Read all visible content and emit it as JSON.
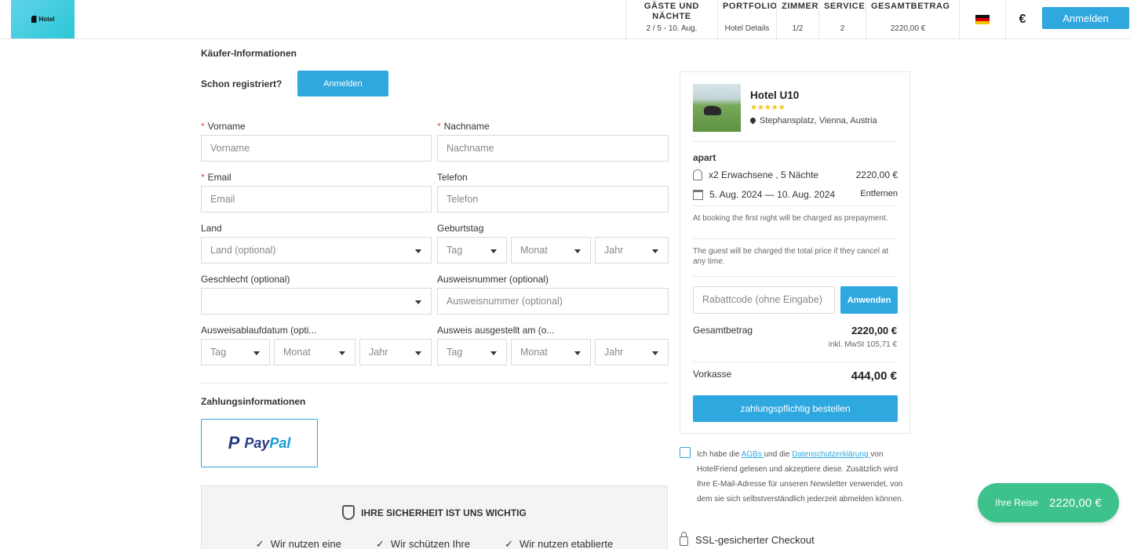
{
  "header": {
    "logo_text": "Hotel",
    "steps": [
      {
        "title": "GÄSTE UND NÄCHTE",
        "value": "2 / 5 - 10. Aug."
      },
      {
        "title": "PORTFOLIO",
        "value": "Hotel Details"
      },
      {
        "title": "ZIMMER",
        "value": "1/2"
      },
      {
        "title": "SERVICE",
        "value": "2"
      },
      {
        "title": "GESAMTBETRAG",
        "value": "2220,00 €"
      }
    ],
    "language_icon": "german-flag",
    "currency_symbol": "€",
    "login_label": "Anmelden"
  },
  "form": {
    "section_title": "Käufer-Informationen",
    "already_registered": "Schon registriert?",
    "login_label": "Anmelden",
    "firstname": {
      "label": "Vorname",
      "placeholder": "Vorname"
    },
    "lastname": {
      "label": "Nachname",
      "placeholder": "Nachname"
    },
    "email": {
      "label": "Email",
      "placeholder": "Email"
    },
    "phone": {
      "label": "Telefon",
      "placeholder": "Telefon"
    },
    "country": {
      "label": "Land",
      "placeholder": "Land (optional)"
    },
    "birthday": {
      "label": "Geburtstag",
      "day": "Tag",
      "month": "Monat",
      "year": "Jahr"
    },
    "gender": {
      "label": "Geschlecht (optional)",
      "value": ""
    },
    "id_number": {
      "label": "Ausweisnummer (optional)",
      "placeholder": "Ausweisnummer (optional)"
    },
    "id_expiry": {
      "label": "Ausweisablaufdatum (opti...",
      "day": "Tag",
      "month": "Monat",
      "year": "Jahr"
    },
    "id_issued": {
      "label": "Ausweis ausgestellt am (o...",
      "day": "Tag",
      "month": "Monat",
      "year": "Jahr"
    },
    "required_mark": "*"
  },
  "payment": {
    "section_title": "Zahlungsinformationen",
    "paypal_p": "P",
    "paypal_word_1": "Pay",
    "paypal_word_2": "Pal"
  },
  "security": {
    "title": "IHRE SICHERHEIT IST UNS WICHTIG",
    "check_mark": "✓",
    "items": [
      "Wir nutzen eine",
      "Wir schützen Ihre",
      "Wir nutzen etablierte"
    ]
  },
  "summary": {
    "hotel_name": "Hotel U10",
    "stars": "★★★★★",
    "address": "Stephansplatz, Vienna, Austria",
    "room_type": "apart",
    "guests": "x2 Erwachsene , 5 Nächte",
    "price": "2220,00 €",
    "dates": "5. Aug. 2024 — 10. Aug. 2024",
    "remove_label": "Entfernen",
    "note_prepayment": "At booking the first night will be charged as prepayment.",
    "note_cancel": "The guest will be charged the total price if they cancel at any time.",
    "coupon_placeholder": "Rabattcode (ohne Eingabe)",
    "apply_label": "Anwenden",
    "total_label": "Gesamtbetrag",
    "total_value": "2220,00 €",
    "vat_text": "inkl. MwSt 105,71 €",
    "prepay_label": "Vorkasse",
    "prepay_value": "444,00 €",
    "order_label": "zahlungspflichtig bestellen"
  },
  "terms": {
    "text_1": "Ich habe die ",
    "agb_link": "AGBs ",
    "text_2": "und die ",
    "privacy_link": "Datenschutzerklärung ",
    "text_3": "von HotelFriend gelesen und akzeptiere diese. Zusätzlich wird Ihre E-Mail-Adresse für unseren Newsletter verwendet, von dem sie sich selbstverständlich jederzeit abmelden können."
  },
  "ssl_text": "SSL-gesicherter Checkout",
  "trip": {
    "label": "Ihre Reise",
    "amount": "2220,00 €"
  },
  "colors": {
    "accent": "#2fa8e0",
    "trip": "#3cc28a",
    "required": "#e74c3c"
  }
}
